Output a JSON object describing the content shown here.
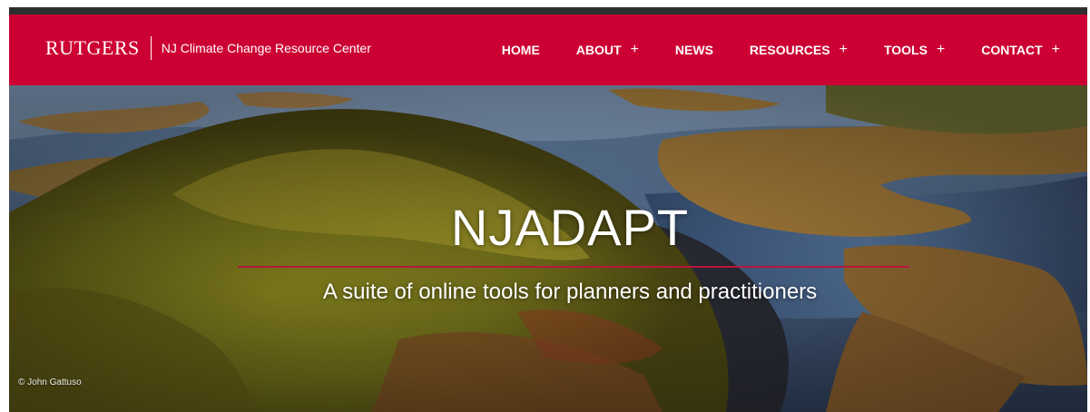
{
  "header": {
    "brand_logo": "RUTGERS",
    "brand_title": "NJ Climate Change Resource Center"
  },
  "nav": {
    "items": [
      {
        "label": "HOME",
        "expandable": false
      },
      {
        "label": "ABOUT",
        "expandable": true
      },
      {
        "label": "NEWS",
        "expandable": false
      },
      {
        "label": "RESOURCES",
        "expandable": true
      },
      {
        "label": "TOOLS",
        "expandable": true
      },
      {
        "label": "CONTACT",
        "expandable": true
      }
    ],
    "expand_symbol": "+"
  },
  "hero": {
    "title": "NJADAPT",
    "subtitle": "A suite of online tools for planners and practitioners",
    "photo_credit": "© John Gattuso"
  },
  "colors": {
    "brand_red": "#cc0033",
    "top_strip": "#2e2e2e",
    "divider_red": "#b8163a"
  }
}
